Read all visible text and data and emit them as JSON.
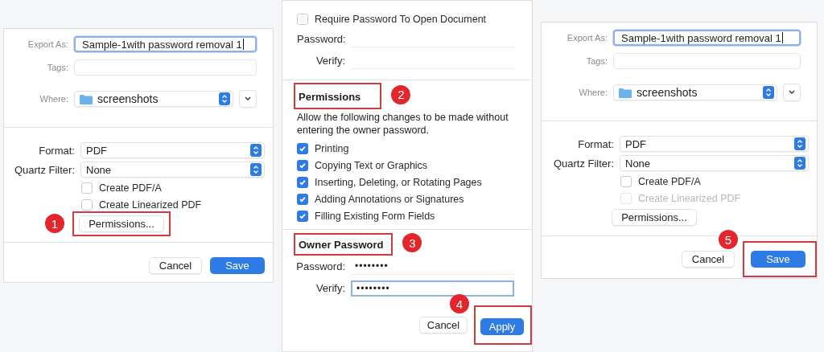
{
  "panels": [
    {
      "kind": "export",
      "export_as": {
        "label": "Export As:",
        "value": "Sample-1with password removal 1",
        "focused": true
      },
      "tags": {
        "label": "Tags:"
      },
      "where": {
        "label": "Where:",
        "value": "screenshots"
      },
      "format": {
        "label": "Format:",
        "value": "PDF"
      },
      "quartz": {
        "label": "Quartz Filter:",
        "value": "None"
      },
      "options": [
        {
          "label": "Create PDF/A",
          "checked": false,
          "disabled": false
        },
        {
          "label": "Create Linearized PDF",
          "checked": false,
          "disabled": false
        }
      ],
      "permissions_button": {
        "label": "Permissions...",
        "step": "1"
      },
      "cancel_button": {
        "label": "Cancel"
      },
      "save_button": {
        "label": "Save"
      }
    },
    {
      "kind": "permissions",
      "require": {
        "label": "Require Password To Open Document",
        "checked": false
      },
      "open_fields": [
        {
          "label": "Password:"
        },
        {
          "label": "Verify:"
        }
      ],
      "permissions_heading": {
        "text": "Permissions",
        "step": "2"
      },
      "description": "Allow the following changes to be made without entering the owner password.",
      "permissions": [
        {
          "label": "Printing",
          "checked": true
        },
        {
          "label": "Copying Text or Graphics",
          "checked": true
        },
        {
          "label": "Inserting, Deleting, or Rotating Pages",
          "checked": true
        },
        {
          "label": "Adding Annotations or Signatures",
          "checked": true
        },
        {
          "label": "Filling Existing Form Fields",
          "checked": true
        }
      ],
      "owner_heading": {
        "text": "Owner Password",
        "step": "3"
      },
      "owner_fields": [
        {
          "label": "Password:",
          "value": "••••••••",
          "focused": false
        },
        {
          "label": "Verify:",
          "value": "••••••••",
          "focused": true
        }
      ],
      "cancel_button": {
        "label": "Cancel"
      },
      "apply_button": {
        "label": "Apply",
        "step": "4"
      }
    },
    {
      "kind": "export",
      "export_as": {
        "label": "Export As:",
        "value": "Sample-1with password removal 1",
        "focused": true
      },
      "tags": {
        "label": "Tags:"
      },
      "where": {
        "label": "Where:",
        "value": "screenshots"
      },
      "format": {
        "label": "Format:",
        "value": "PDF"
      },
      "quartz": {
        "label": "Quartz Filter:",
        "value": "None"
      },
      "options": [
        {
          "label": "Create PDF/A",
          "checked": false,
          "disabled": false
        },
        {
          "label": "Create Linearized PDF",
          "checked": false,
          "disabled": true
        }
      ],
      "permissions_button": {
        "label": "Permissions..."
      },
      "cancel_button": {
        "label": "Cancel"
      },
      "save_button": {
        "label": "Save",
        "step": "5"
      }
    }
  ]
}
